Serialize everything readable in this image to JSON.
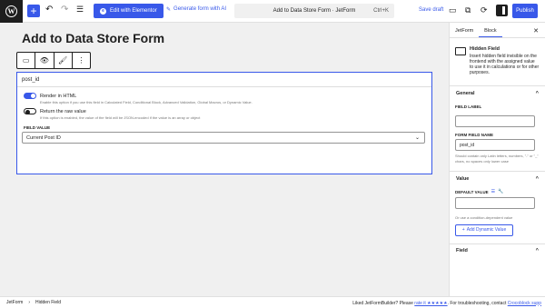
{
  "toolbar": {
    "add_symbol": "+",
    "undo_symbol": "↶",
    "redo_symbol": "↷",
    "list_view_symbol": "☰",
    "elementor_label": "Edit with Elementor",
    "elementor_icon_letter": "e",
    "ai_label": "Generate form with AI",
    "command_bar_title": "Add to Data Store Form · JetForm",
    "command_bar_shortcut": "Ctrl+K",
    "save_draft_label": "Save draft",
    "publish_label": "Publish",
    "wp_logo_letter": "W"
  },
  "editor": {
    "page_title": "Add to Data Store Form",
    "block_toolbar": [
      {
        "icon": "hidden-field-icon",
        "glyph": "▭"
      },
      {
        "icon": "eye-icon",
        "glyph": "👁"
      },
      {
        "icon": "brush-icon",
        "glyph": "🖌"
      },
      {
        "icon": "more-options-icon",
        "glyph": "⋮"
      }
    ],
    "block": {
      "field_name": "post_id",
      "render_in_html": {
        "label": "Render in HTML",
        "help": "Enable this option if you use this field in Calculated Field, Conditional Block, Advanced Validation, Global Macros, or Dynamic Value.",
        "enabled": true
      },
      "return_raw": {
        "label": "Return the raw value",
        "help": "If this option is enabled, the value of the field will be JSON-encoded if the value is an array or object",
        "enabled": false
      },
      "field_value_label": "FIELD VALUE",
      "field_value_selected": "Current Post ID"
    }
  },
  "sidebar": {
    "tabs": [
      {
        "label": "JetForm",
        "active": false
      },
      {
        "label": "Block",
        "active": true
      }
    ],
    "close_symbol": "✕",
    "block_card": {
      "title": "Hidden Field",
      "description": "Insert hidden field invisible on the frontend with the assigned value to use it in calculations or for other purposes."
    },
    "general_header": "General",
    "field_label_label": "FIELD LABEL",
    "field_label_value": "",
    "form_field_name_label": "FORM FIELD NAME",
    "form_field_name_value": "post_id",
    "field_name_help": "Should contain only Latin letters, numbers, \"-\" or \"_\" chars, no spaces only lower case",
    "value_header": "Value",
    "default_value_label": "DEFAULT VALUE",
    "default_value": "",
    "condition_text": "Or use a condition-dependent value",
    "add_dynamic_label": "Add Dynamic Value",
    "field_header": "Field",
    "collapse_symbol": "^"
  },
  "footer": {
    "breadcrumb": [
      "JetForm",
      "Hidden Field"
    ],
    "breadcrumb_sep": "›",
    "right_text_prefix": "Liked JetFormBuilder? Please",
    "rate_link": "rate it ★★★★★",
    "right_text_mid": ". For troubleshooting, contact",
    "support_link": "Crocoblock supp"
  },
  "colors": {
    "accent": "#3858e9",
    "text": "#1e1e1e",
    "background": "#f0f0f0"
  }
}
